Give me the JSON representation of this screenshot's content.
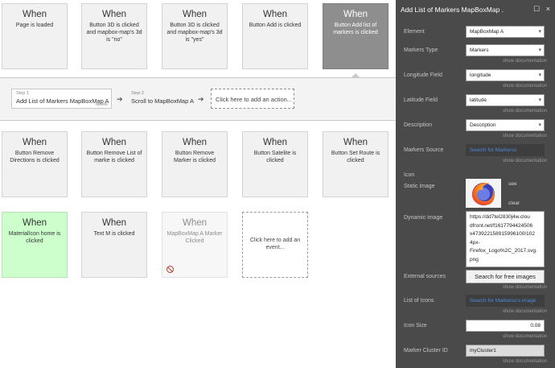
{
  "workflow_cards": [
    {
      "when": "When",
      "desc": "Page is loaded"
    },
    {
      "when": "When",
      "desc": "Button 3D is clicked and mapbox-map's 3d is \"no\""
    },
    {
      "when": "When",
      "desc": "Button 3D is clicked and mapbox-map's 3d is \"yes\""
    },
    {
      "when": "When",
      "desc": "Button Add is clicked"
    },
    {
      "when": "When",
      "desc": "Button Add list of markers is clicked"
    },
    {
      "when": "When",
      "desc": "Button Remove Directions is clicked"
    },
    {
      "when": "When",
      "desc": "Button Remove List of marke is clicked"
    },
    {
      "when": "When",
      "desc": "Button Remove Marker is clicked"
    },
    {
      "when": "When",
      "desc": "Button Satelite is clicked"
    },
    {
      "when": "When",
      "desc": "Button Set Route is clicked"
    },
    {
      "when": "When",
      "desc": "MaterialIcon home is clicked"
    },
    {
      "when": "When",
      "desc": "Text M is clicked"
    },
    {
      "when": "When",
      "desc": "MapBoxMap A Marker Clicked"
    },
    {
      "when": "",
      "desc": "Click here to add an event..."
    }
  ],
  "steps": [
    {
      "num": "Step 1",
      "label": "Add List of Markers MapBoxMap A",
      "delete": "delete"
    },
    {
      "num": "Step 2",
      "label": "Scroll to MapBoxMap A"
    },
    {
      "label": "Click here to add an action..."
    }
  ],
  "arrows": [
    "➔",
    "➔"
  ],
  "panel": {
    "title": "Add List of Markers MapBoxMap .",
    "icons": [
      "comment-icon",
      "close-icon"
    ],
    "icon_glyphs": [
      "☐",
      "×"
    ],
    "show_doc": "show documentation",
    "fields": [
      {
        "label": "Element",
        "value": "MapBoxMap A"
      },
      {
        "label": "Markers Type",
        "value": "Markers"
      },
      {
        "label": "Longitude Field",
        "value": "longitude"
      },
      {
        "label": "Latitude Field",
        "value": "latitude"
      },
      {
        "label": "Description",
        "value": "Description"
      },
      {
        "label": "Markers Source",
        "value": "Search for Markerss"
      }
    ],
    "icon_label": "Icon",
    "static_image_label": "Static image",
    "see": "see",
    "clear": "clear",
    "dynamic_image_label": "Dynamic image",
    "dynamic_image_lines": [
      "https://dd7tel2830j4w.clou",
      "dfront.net/f1617794424506",
      "x473922158915996100/102",
      "4px-",
      "Firefox_Logo%2C_2017.svg.",
      "png"
    ],
    "external_sources_label": "External sources",
    "external_sources_button": "Search for free images",
    "list_of_icons_label": "List of Icons",
    "list_of_icons_value": "Search for Markerss's image",
    "icon_size_label": "Icon Size",
    "icon_size_value": "0.08",
    "cluster_label": "Marker Cluster ID",
    "cluster_value": "myCluster1"
  }
}
